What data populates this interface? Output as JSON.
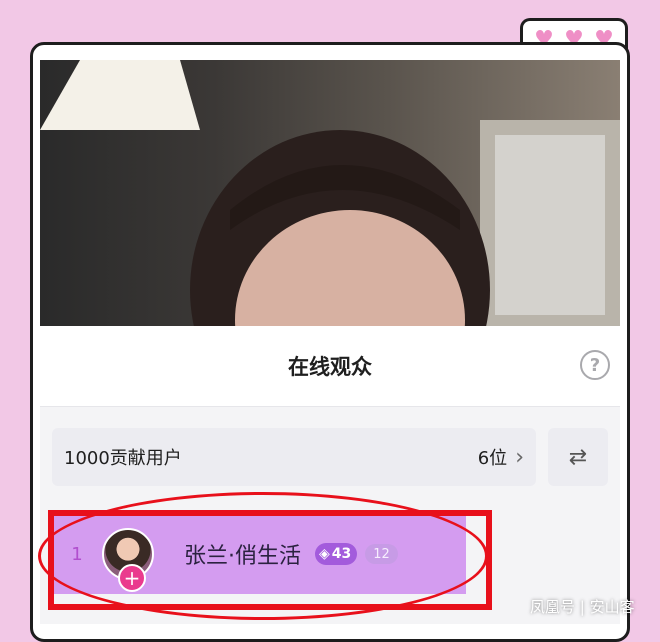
{
  "decor": {
    "hearts": [
      "♥",
      "♥",
      "♥"
    ]
  },
  "panel": {
    "title": "在线观众",
    "help_icon": "question-circle-icon",
    "contributors": {
      "label": "1000贡献用户",
      "count": "6位",
      "chevron": "›"
    },
    "swap_icon": "⇄"
  },
  "user": {
    "rank": "1",
    "name": "张兰·俏生活",
    "level": "43",
    "fan_count": "12",
    "follow_symbol": "+"
  },
  "watermark": "凤凰号 | 安山客",
  "colors": {
    "background": "#f2c8e6",
    "annotation": "#e8101b",
    "highlight": "#d49cf0"
  }
}
